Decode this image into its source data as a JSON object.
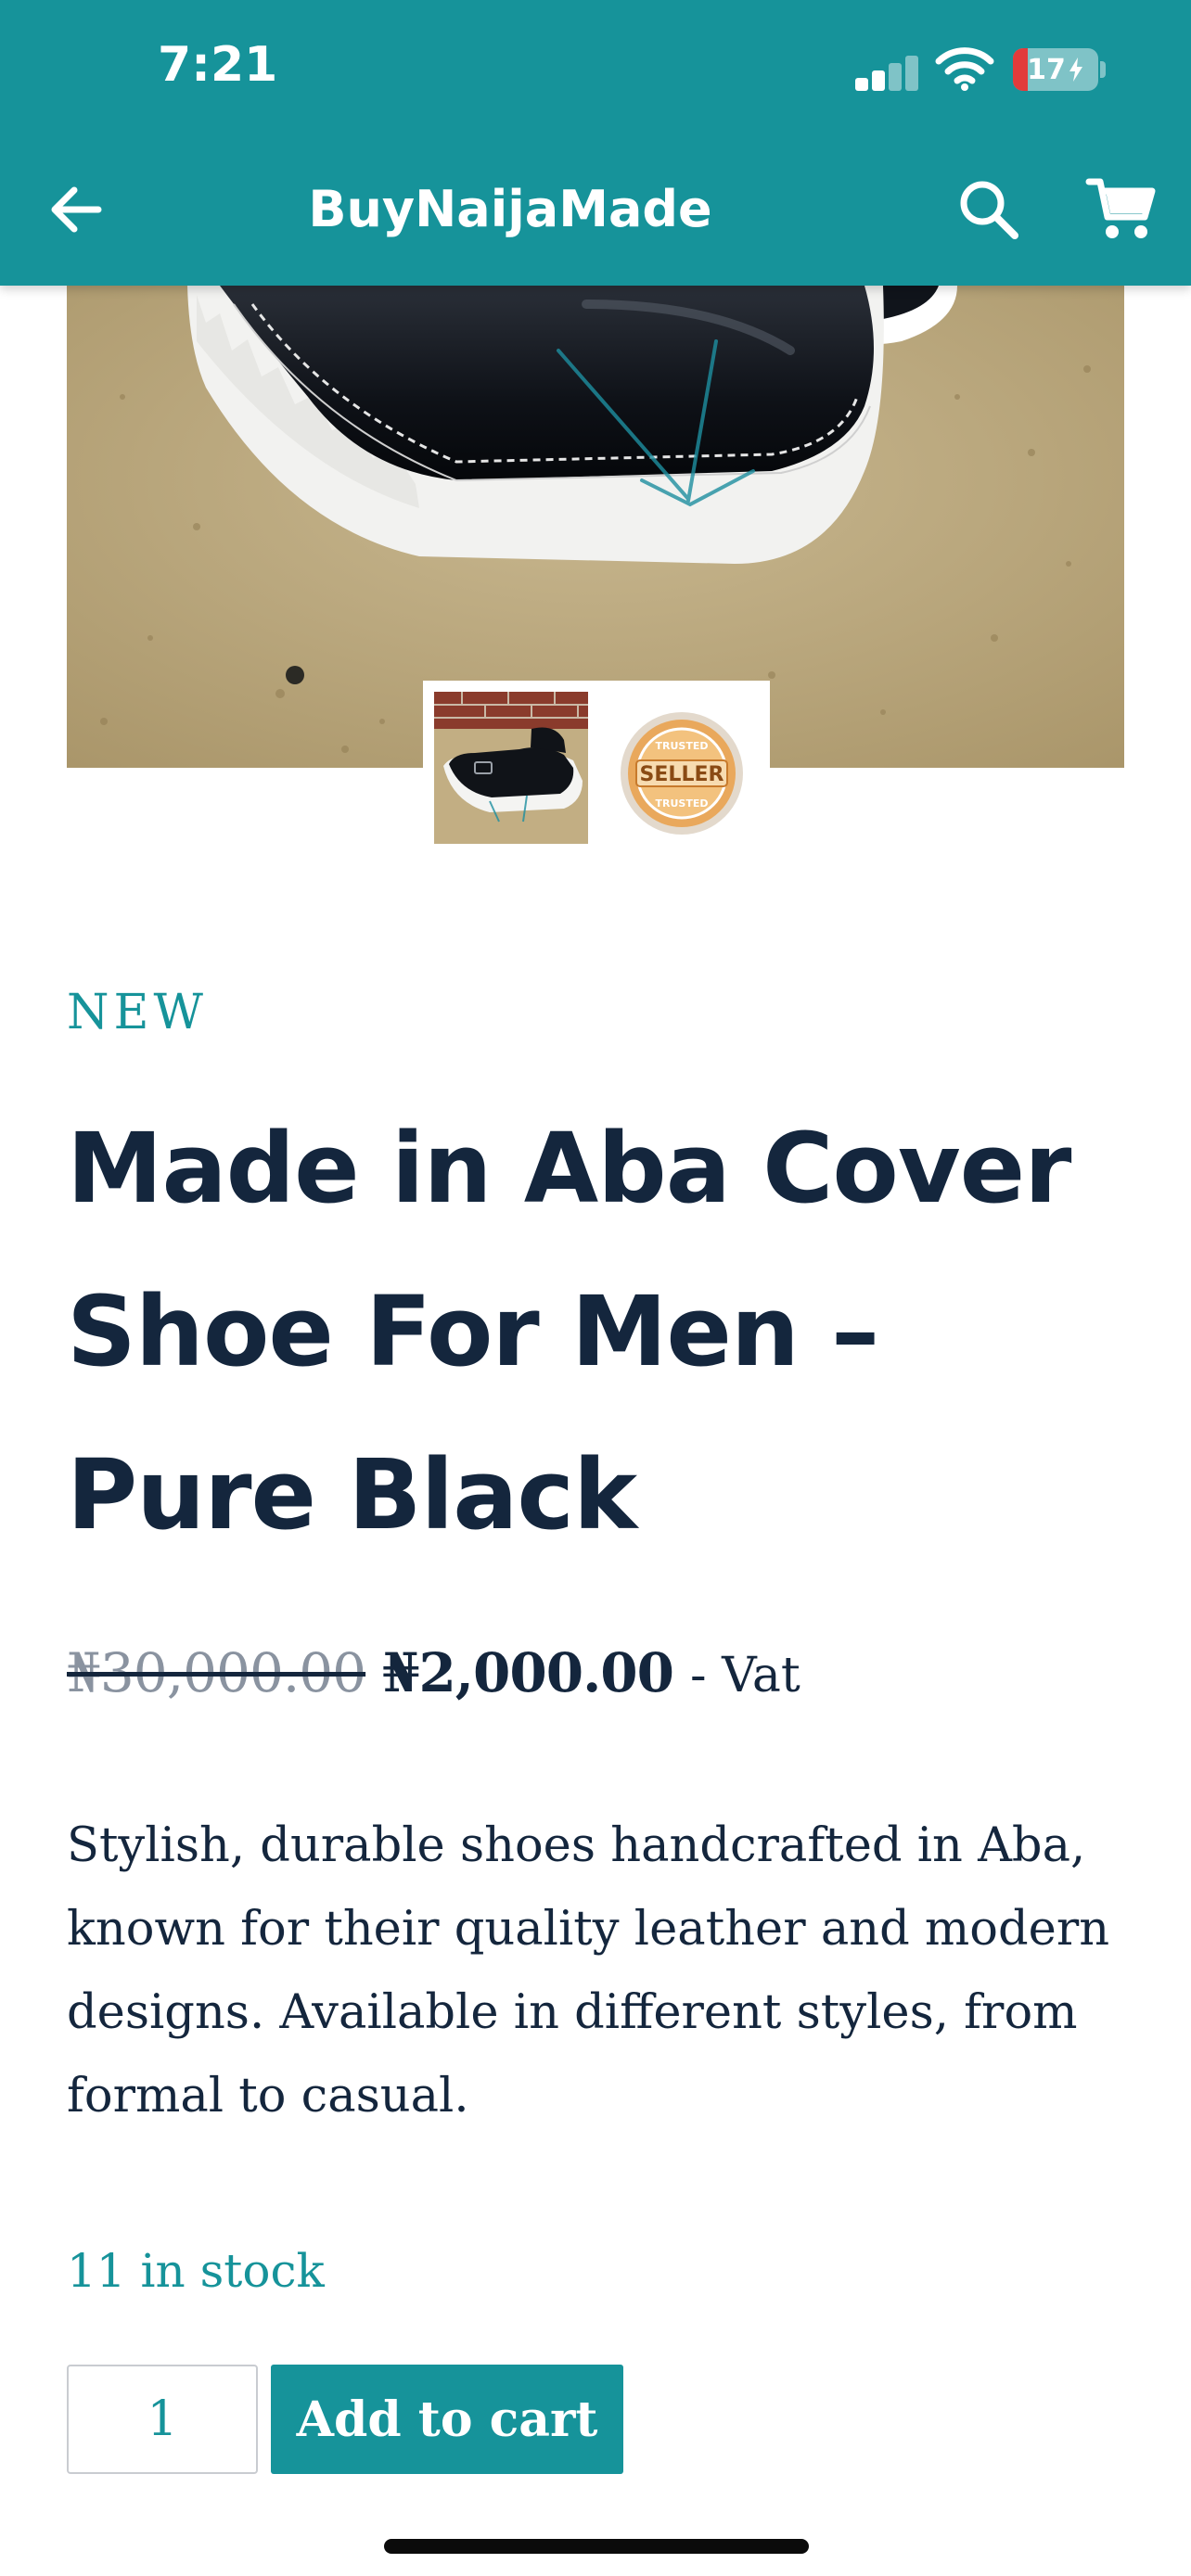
{
  "status_bar": {
    "time": "7:21",
    "battery_level": "17",
    "battery_fraction": 0.17,
    "signal_bars_active": 2,
    "signal_bars_total": 4,
    "icons": [
      "signal-icon",
      "wifi-icon",
      "battery-charging-icon"
    ]
  },
  "app_bar": {
    "title": "BuyNaijaMade",
    "icons": [
      "back-arrow-icon",
      "search-icon",
      "cart-icon"
    ]
  },
  "gallery": {
    "main_image": "black leather cover shoe with white ridged sole on sand",
    "thumbnails": [
      "shoe-photo-thumbnail",
      "trusted-seller-badge-thumbnail"
    ],
    "badge_words": {
      "top": "TRUSTED",
      "middle": "SELLER",
      "bottom": "TRUSTED"
    }
  },
  "product": {
    "badge": "NEW",
    "title": "Made in Aba Cover Shoe For Men – Pure Black",
    "old_price": "₦30,000.00",
    "new_price": "₦2,000.00",
    "vat_note": "- Vat",
    "description": "Stylish, durable shoes handcrafted in Aba, known for their quality leather and modern designs. Available in different styles, from formal to casual.",
    "stock": "11 in stock",
    "quantity": "1",
    "add_to_cart_label": "Add to cart"
  },
  "colors": {
    "brand": "#16939a",
    "text_dark": "#14263d",
    "strike_grey": "#8a93a0",
    "battery_low": "#e23b3b"
  }
}
